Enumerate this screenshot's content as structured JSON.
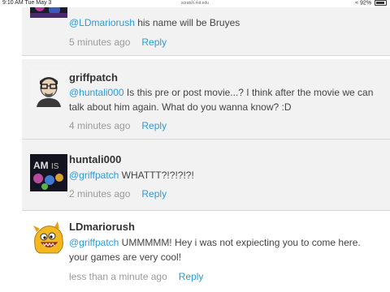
{
  "status_bar": {
    "time": "9:10 AM   Tue May 3",
    "url": "scratch.mit.edu",
    "battery": "92%",
    "wifi_icon": "wifi-icon",
    "battery_icon": "battery-icon"
  },
  "comments": [
    {
      "username": "",
      "mention": "@LDmariorush",
      "text": " his name will be Bruyes",
      "time": "5 minutes ago",
      "reply": "Reply"
    },
    {
      "username": "griffpatch",
      "mention": "@huntali000",
      "text": " Is this pre or post movie...? I think after the movie we can talk about him again. What do you wanna know? :D",
      "time": "4 minutes ago",
      "reply": "Reply"
    },
    {
      "username": "huntali000",
      "mention": "@griffpatch",
      "text": " WHATTT?!?!?!?!",
      "time": "2 minutes ago",
      "reply": "Reply"
    },
    {
      "username": "LDmariorush",
      "mention": "@griffpatch",
      "text": " UMMMMM! Hey i was not expiecting you to come here. your games are very cool!",
      "time": "less than a minute ago",
      "reply": "Reply"
    }
  ]
}
